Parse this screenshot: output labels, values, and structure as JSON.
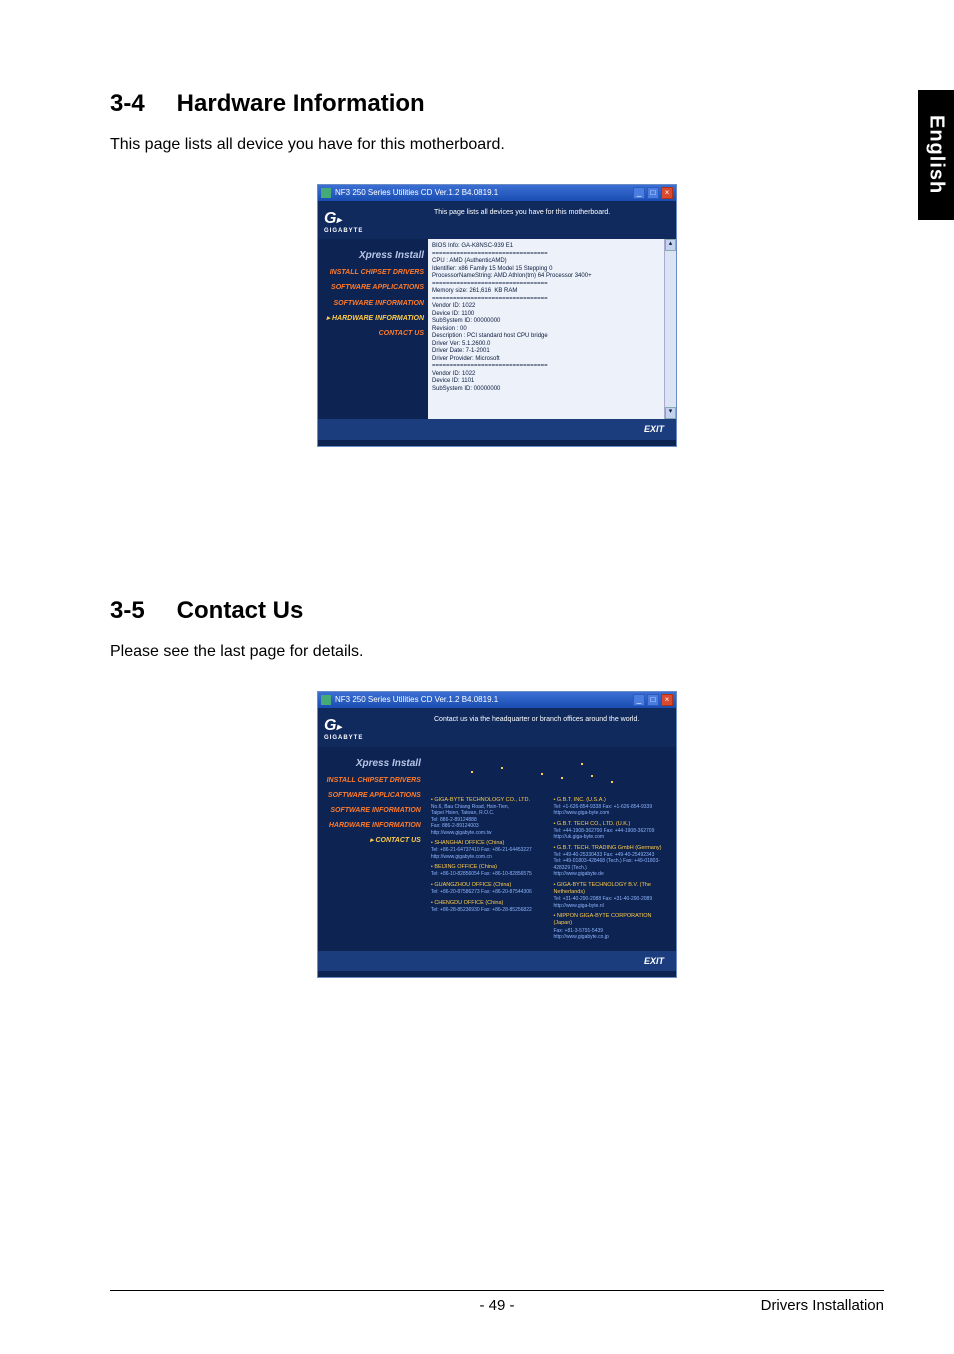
{
  "side_tab": "English",
  "section1": {
    "num": "3-4",
    "title": "Hardware Information",
    "text": "This page lists all device you have for this motherboard."
  },
  "section2": {
    "num": "3-5",
    "title": "Contact Us",
    "text": "Please see the last page for details."
  },
  "footer": {
    "page_num": "- 49 -",
    "right": "Drivers Installation"
  },
  "screenshot_common": {
    "window_title": "NF3 250 Series Utilities CD Ver.1.2 B4.0819.1",
    "brand": "GIGABYTE",
    "exit_label": "EXIT",
    "menu": {
      "xpress": "Xpress Install",
      "chipset": "INSTALL CHIPSET DRIVERS",
      "apps": "SOFTWARE APPLICATIONS",
      "swinfo": "SOFTWARE INFORMATION",
      "hwinfo": "HARDWARE INFORMATION",
      "contact": "CONTACT US"
    }
  },
  "screenshot1": {
    "header_msg": "This page lists all devices you have for this motherboard.",
    "content": "BIOS Info: GA-K8NSC-939 E1\n=================================\nCPU : AMD (AuthenticAMD)\nIdentifier: x86 Family 15 Model 15 Stepping 0\nProcessorNameString: AMD Athlon(tm) 64 Processor 3400+\n=================================\nMemory size: 261,616  KB RAM\n=================================\nVendor ID: 1022\nDevice ID: 1100\nSubSystem ID: 00000000\nRevision : 00\nDescription : PCI standard host CPU bridge\nDriver Ver: 5.1.2600.0\nDriver Date: 7-1-2001\nDriver Provider: Microsoft\n=================================\nVendor ID: 1022\nDevice ID: 1101\nSubSystem ID: 00000000"
  },
  "screenshot2": {
    "header_msg": "Contact us via the headquarter or branch offices around the world.",
    "left_col": [
      {
        "name": "• GIGA-BYTE TECHNOLOGY CO., LTD.",
        "lines": [
          "No.6, Bau Chiang Road, Hsin-Tien,",
          "Taipei Hsien, Taiwan, R.O.C.",
          "Tel: 886-2-89124888",
          "Fax: 886-2-89124003",
          "http://www.gigabyte.com.tw"
        ]
      },
      {
        "name": "• SHANGHAI OFFICE (China)",
        "lines": [
          "Tel: +86-21-64737410  Fax: +86-21-64453227",
          "http://www.gigabyte.com.cn"
        ]
      },
      {
        "name": "• BEIJING OFFICE (China)",
        "lines": [
          "Tel: +86-10-82856054  Fax: +86-10-82856575"
        ]
      },
      {
        "name": "• GUANGZHOU OFFICE (China)",
        "lines": [
          "Tel: +86-20-87586273  Fax: +86-20-87544306"
        ]
      },
      {
        "name": "• CHENGDU OFFICE (China)",
        "lines": [
          "Tel: +86-28-85236930  Fax: +86-28-85256822"
        ]
      }
    ],
    "right_col": [
      {
        "name": "• G.B.T. INC. (U.S.A.)",
        "lines": [
          "Tel: +1-626-854-9338  Fax: +1-626-854-9339",
          "http://www.giga-byte.com"
        ]
      },
      {
        "name": "• G.B.T. TECH CO., LTD. (U.K.)",
        "lines": [
          "Tel: +44-1908-362700  Fax: +44-1908-362709",
          "http://uk.giga-byte.com"
        ]
      },
      {
        "name": "• G.B.T. TECH. TRADING GmbH (Germany)",
        "lines": [
          "Tel: +49-40-25330433  Fax: +49-40-25492343",
          "Tel: +49-01803-428468 (Tech.)  Fax: +49-01803-428329 (Tech.)",
          "http://www.gigabyte.de"
        ]
      },
      {
        "name": "• GIGA-BYTE TECHNOLOGY B.V. (The Netherlands)",
        "lines": [
          "Tel: +31-40-290-2088  Fax: +31-40-290-2089",
          "http://www.giga-byte.nl"
        ]
      },
      {
        "name": "• NIPPON GIGA-BYTE CORPORATION (Japan)",
        "lines": [
          "Fax: +81-3-5791-5439",
          "http://www.gigabyte.co.jp"
        ]
      }
    ]
  }
}
